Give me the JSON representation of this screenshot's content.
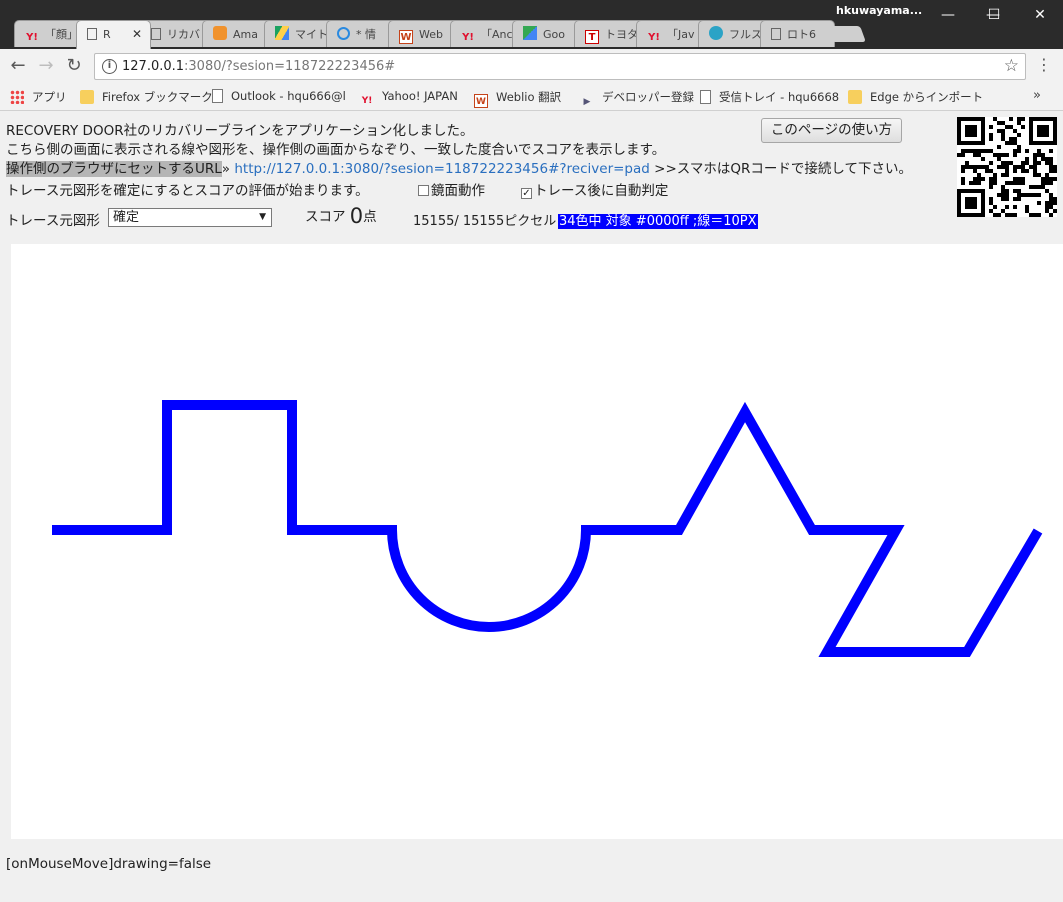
{
  "window": {
    "user": "hkuwayama...",
    "minimize": "—",
    "maximize": "☐",
    "close": "✕"
  },
  "tabs": [
    {
      "fav": "Y!",
      "label": "「顔」"
    },
    {
      "fav": "",
      "label": "R",
      "active": true
    },
    {
      "fav": "",
      "label": "リカバ"
    },
    {
      "fav": "",
      "label": "Ama"
    },
    {
      "fav": "",
      "label": "マイト"
    },
    {
      "fav": "",
      "label": "* 情"
    },
    {
      "fav": "W",
      "label": "Web"
    },
    {
      "fav": "Y!",
      "label": "「Anc"
    },
    {
      "fav": "",
      "label": "Goo"
    },
    {
      "fav": "T",
      "label": "トヨタ"
    },
    {
      "fav": "Y!",
      "label": "「Jav"
    },
    {
      "fav": "",
      "label": "フルス"
    },
    {
      "fav": "",
      "label": "ロト6"
    }
  ],
  "toolbar": {
    "back": "←",
    "forward": "→",
    "reload": "↻",
    "url_host": "127.0.0.1",
    "url_rest": ":3080/?sesion=118722223456#",
    "star": "☆",
    "menu": "⋮"
  },
  "bookmarks": [
    {
      "label": "アプリ",
      "icon": "apps-grid"
    },
    {
      "label": "Firefox ブックマーク",
      "icon": "folder"
    },
    {
      "label": "Outlook - hqu666@l",
      "icon": "page"
    },
    {
      "label": "Yahoo! JAPAN",
      "icon": "yahoo"
    },
    {
      "label": "Weblio 翻訳",
      "icon": "weblio"
    },
    {
      "label": "デベロッパー登録",
      "icon": "dev"
    },
    {
      "label": "受信トレイ - hqu6668",
      "icon": "page"
    },
    {
      "label": "Edge からインポート",
      "icon": "folder"
    },
    {
      "label": "»",
      "icon": ""
    }
  ],
  "page": {
    "intro_1": "RECOVERY DOOR社のリカバリーブラインをアプリケーション化しました。",
    "intro_2": "こちら側の画面に表示される線や図形を、操作側の画面からなぞり、一致した度合いでスコアを表示します。",
    "url_label": "操作側のブラウザにセットするURL",
    "url_arrow": "»",
    "url_link": "http://127.0.0.1:3080/?sesion=118722223456#?reciver=pad",
    "url_note": ">>スマホはQRコードで接続して下さい。",
    "howto_button": "このページの使い方",
    "trace_note": "トレース元図形を確定にするとスコアの評価が始まります。",
    "mirror_label": "鏡面動作",
    "mirror_checked": false,
    "auto_label": "トレース後に自動判定",
    "auto_checked": true,
    "shape_label": "トレース元図形",
    "shape_value": "確定",
    "score_label": "スコア",
    "score_value": "0",
    "score_unit": "点",
    "pixels": "15155/ 15155ピクセル",
    "color_info": "34色中 対象 #0000ff ;線＝10PX",
    "status": "[onMouseMove]drawing=false",
    "stroke_color": "#0000ff",
    "stroke_width_px": 10
  }
}
